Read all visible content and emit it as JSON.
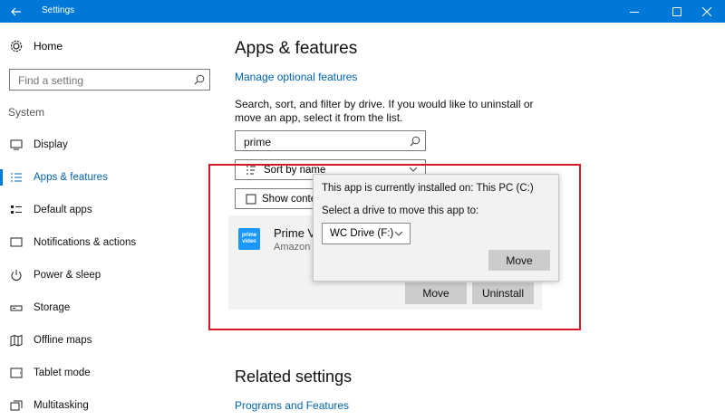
{
  "window": {
    "title": "Settings",
    "back_icon": "back-arrow-icon",
    "controls": [
      "minimize",
      "maximize",
      "close"
    ]
  },
  "sidebar": {
    "home_label": "Home",
    "search_placeholder": "Find a setting",
    "section_label": "System",
    "items": [
      {
        "label": "Display",
        "icon": "display-icon"
      },
      {
        "label": "Apps & features",
        "icon": "apps-features-icon",
        "selected": true
      },
      {
        "label": "Default apps",
        "icon": "default-apps-icon"
      },
      {
        "label": "Notifications & actions",
        "icon": "notifications-icon"
      },
      {
        "label": "Power & sleep",
        "icon": "power-icon"
      },
      {
        "label": "Storage",
        "icon": "storage-icon"
      },
      {
        "label": "Offline maps",
        "icon": "map-icon"
      },
      {
        "label": "Tablet mode",
        "icon": "tablet-icon"
      },
      {
        "label": "Multitasking",
        "icon": "multitasking-icon"
      }
    ]
  },
  "main": {
    "title": "Apps & features",
    "manage_link": "Manage optional features",
    "description": "Search, sort, and filter by drive. If you would like to uninstall or move an app, select it from the list.",
    "search_value": "prime",
    "sort_label": "Sort by name",
    "filter_label": "Show conte",
    "app": {
      "name": "Prime V",
      "publisher": "Amazon",
      "icon_text_line1": "prime",
      "icon_text_line2": "video",
      "move_label": "Move",
      "uninstall_label": "Uninstall"
    },
    "popup": {
      "installed_text": "This app is currently installed on: This PC (C:)",
      "select_text": "Select a drive to move this app to:",
      "drive_value": "WC Drive (F:)",
      "move_label": "Move"
    },
    "related_title": "Related settings",
    "related_link": "Programs and Features"
  },
  "colors": {
    "accent": "#0078d7",
    "link": "#0063b1",
    "highlight_box": "#d21a2a",
    "button": "#cccccc"
  }
}
